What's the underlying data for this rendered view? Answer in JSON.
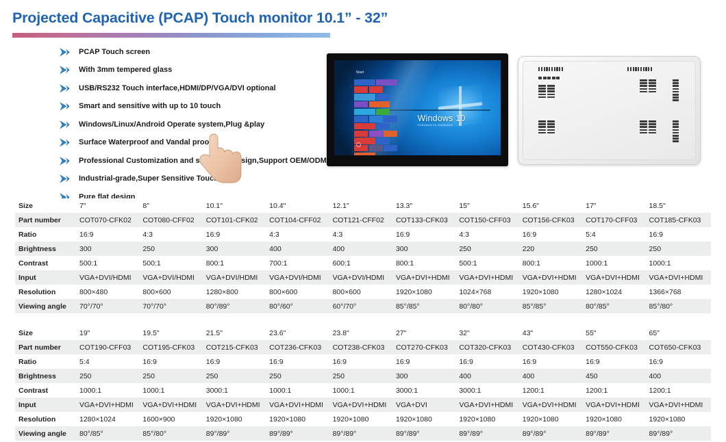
{
  "page": {
    "title": "Projected Capacitive (PCAP) Touch monitor 10.1” - 32”",
    "title_color": "#1f63b4"
  },
  "features": {
    "icon": "blue-chevron-arrow-icon",
    "items": [
      "PCAP Touch screen",
      "With 3mm tempered glass",
      "USB/RS232 Touch interface,HDMI/DP/VGA/DVI optional",
      "Smart and sensitive with up to 10 touch",
      "Windows/Linux/Android Operate system,Plug &play",
      "Surface Waterproof and Vandal proof",
      "Professional Customization and structural design,Support OEM/ODM",
      "Industrial-grade,Super Sensitive Touch",
      "Pure flat design"
    ]
  },
  "photos": {
    "front": {
      "name": "pcap-touch-monitor-front-view",
      "screen_text": "Windows 10",
      "screen_subtext": "Professional for workstations",
      "start_label": "Start",
      "tile_colors": [
        "#2e63c8",
        "#7a4fc4",
        "#d93b3b",
        "#d93b3b",
        "#3a9ad9",
        "#2e63c8",
        "#7a4fc4",
        "#e0612e",
        "#2fa7de",
        "#3ba93b",
        "#2e63c8",
        "#2e7dd6",
        "#2e63c8",
        "#d93b3b",
        "#2e63c8",
        "#d93b3b",
        "#8a4fc4",
        "#e0612e",
        "#d93b3b",
        "#2e63c8",
        "#d93b3b",
        "#5a5a8a",
        "#2e63c8",
        "#e0612e"
      ]
    },
    "back": {
      "name": "pcap-touch-monitor-rear-view"
    }
  },
  "tables": [
    {
      "id": "table-1",
      "rows": [
        {
          "label": "Size",
          "values": [
            "7\"",
            "8\"",
            "10.1\"",
            "10.4\"",
            "12.1\"",
            "13.3\"",
            "15\"",
            "15.6\"",
            "17\"",
            "18.5\""
          ]
        },
        {
          "label": "Part number",
          "values": [
            "COT070-CFK02",
            "COT080-CFF02",
            "COT101-CFK02",
            "COT104-CFF02",
            "COT121-CFF02",
            "COT133-CFK03",
            "COT150-CFF03",
            "COT156-CFK03",
            "COT170-CFF03",
            "COT185-CFK03"
          ]
        },
        {
          "label": "Ratio",
          "values": [
            "16:9",
            "4:3",
            "16:9",
            "4:3",
            "4:3",
            "16:9",
            "4:3",
            "16:9",
            "5:4",
            "16:9"
          ]
        },
        {
          "label": "Brightness",
          "values": [
            "300",
            "250",
            "300",
            "400",
            "400",
            "300",
            "250",
            "220",
            "250",
            "250"
          ]
        },
        {
          "label": "Contrast",
          "values": [
            "500:1",
            "500:1",
            "800:1",
            "700:1",
            "600:1",
            "800:1",
            "500:1",
            "800:1",
            "1000:1",
            "1000:1"
          ]
        },
        {
          "label": "Input",
          "values": [
            "VGA+DVI/HDMI",
            "VGA+DVI/HDMI",
            "VGA+DVI/HDMI",
            "VGA+DVI/HDMI",
            "VGA+DVI/HDMI",
            "VGA+DVI+HDMI",
            "VGA+DVI+HDMI",
            "VGA+DVI+HDMI",
            "VGA+DVI+HDMI",
            "VGA+DVI+HDMI"
          ]
        },
        {
          "label": "Resolution",
          "values": [
            "800×480",
            "800×600",
            "1280×800",
            "800×600",
            "800×600",
            "1920×1080",
            "1024×768",
            "1920×1080",
            "1280×1024",
            "1366×768"
          ]
        },
        {
          "label": "Viewing angle",
          "values": [
            "70°/70°",
            "70°/70°",
            "80°/89°",
            "80°/60°",
            "60°/70°",
            "85°/85°",
            "80°/80°",
            "85°/85°",
            "80°/85°",
            "85°/80°"
          ]
        }
      ]
    },
    {
      "id": "table-2",
      "rows": [
        {
          "label": "Size",
          "values": [
            "19\"",
            "19.5\"",
            "21.5\"",
            "23.6\"",
            "23.8\"",
            "27\"",
            "32\"",
            "43\"",
            "55\"",
            "65\""
          ]
        },
        {
          "label": "Part number",
          "values": [
            "COT190-CFF03",
            "COT195-CFK03",
            "COT215-CFK03",
            "COT236-CFK03",
            "COT238-CFK03",
            "COT270-CFK03",
            "COT320-CFK03",
            "COT430-CFK03",
            "COT550-CFK03",
            "COT650-CFK03"
          ]
        },
        {
          "label": "Ratio",
          "values": [
            "5:4",
            "16:9",
            "16:9",
            "16:9",
            "16:9",
            "16:9",
            "16:9",
            "16:9",
            "16:9",
            "16:9"
          ]
        },
        {
          "label": "Brightness",
          "values": [
            "250",
            "250",
            "250",
            "250",
            "250",
            "300",
            "400",
            "400",
            "450",
            "400"
          ]
        },
        {
          "label": "Contrast",
          "values": [
            "1000:1",
            "1000:1",
            "3000:1",
            "1000:1",
            "1000:1",
            "3000:1",
            "3000:1",
            "1200:1",
            "1200:1",
            "1200:1"
          ]
        },
        {
          "label": "Input",
          "values": [
            "VGA+DVI+HDMI",
            "VGA+DVI+HDMI",
            "VGA+DVI+HDMI",
            "VGA+DVI+HDMI",
            "VGA+DVI+HDMI",
            "VGA+DVI",
            "VGA+DVI+HDMI",
            "VGA+DVI+HDMI",
            "VGA+DVI+HDMI",
            "VGA+DVI+HDMI"
          ]
        },
        {
          "label": "Resolution",
          "values": [
            "1280×1024",
            "1600×900",
            "1920×1080",
            "1920×1080",
            "1920×1080",
            "1920×1080",
            "1920×1080",
            "1920×1080",
            "1920×1080",
            "1920×1080"
          ]
        },
        {
          "label": "Viewing angle",
          "values": [
            "80°/85°",
            "85°/80°",
            "89°/89°",
            "89°/89°",
            "89°/89°",
            "89°/89°",
            "89°/89°",
            "89°/89°",
            "89°/89°",
            "89°/89°"
          ]
        }
      ]
    }
  ]
}
